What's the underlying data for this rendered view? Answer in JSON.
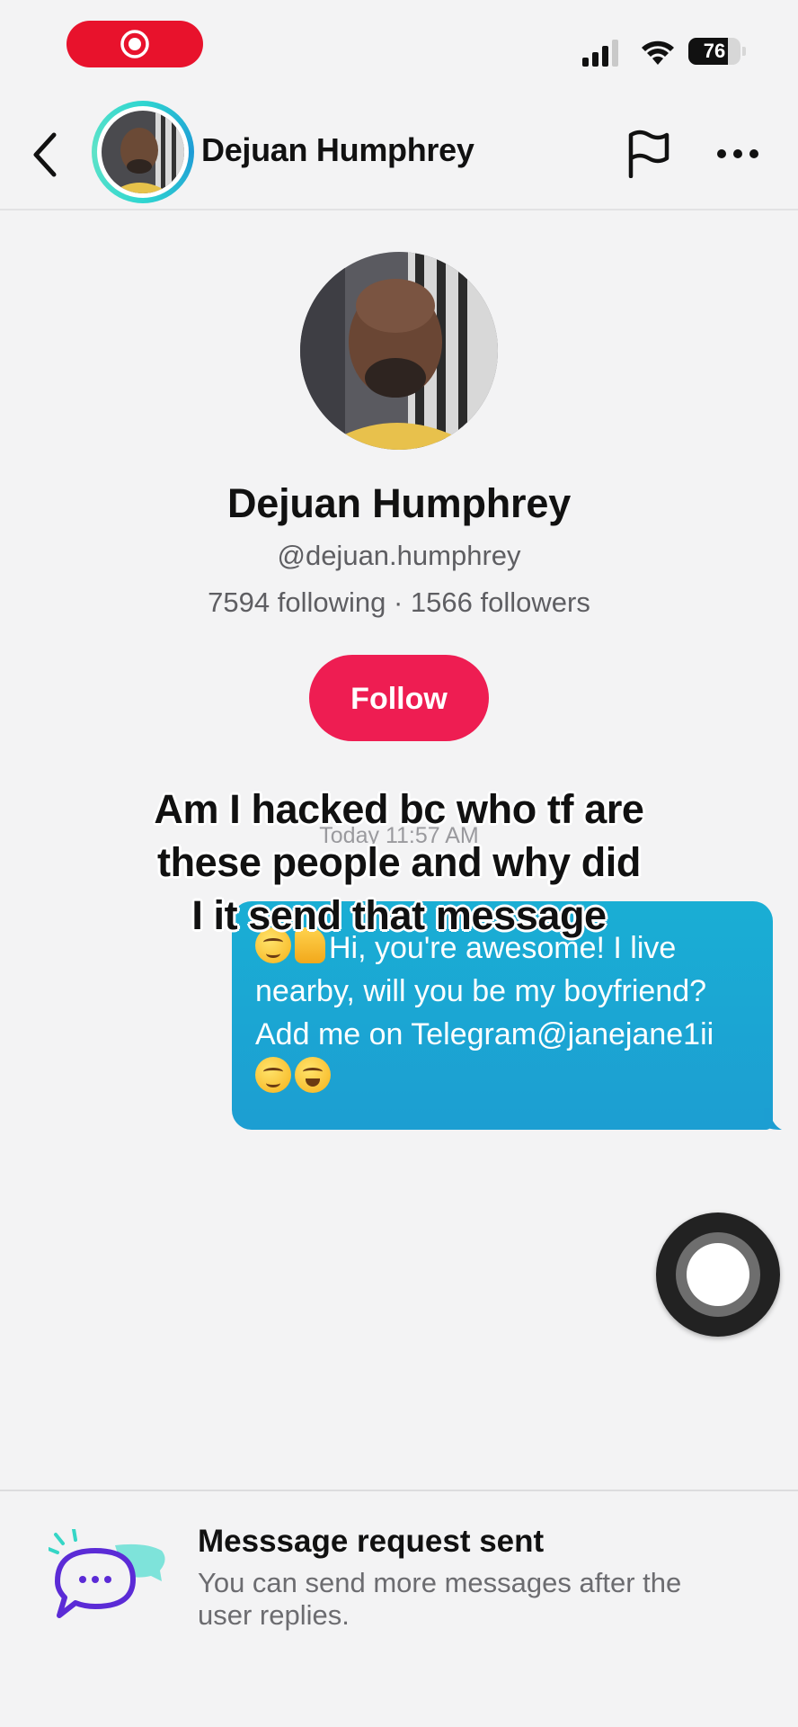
{
  "status_bar": {
    "battery_level": "76",
    "battery_fraction": 0.76,
    "icons": [
      "screen-recording-icon",
      "cellular-signal-icon",
      "wifi-icon",
      "battery-icon"
    ]
  },
  "header": {
    "name": "Dejuan Humphrey",
    "icons": [
      "back-chevron-icon",
      "flag-icon",
      "more-dots-icon"
    ]
  },
  "profile": {
    "name": "Dejuan Humphrey",
    "handle": "@dejuan.humphrey",
    "stats": "7594 following · 1566 followers",
    "follow_label": "Follow"
  },
  "chat": {
    "timestamp": "Today 11:57 AM",
    "message": {
      "line1": "Hi, you're awesome! I live",
      "line2": "nearby, will you be my boyfriend?",
      "line3": "Add me on Telegram@janejane1ii"
    }
  },
  "overlay_caption": {
    "line1": "Am I hacked bc who tf are",
    "line2": "these people and why did",
    "line3": "I it send that message"
  },
  "footer": {
    "title": "Messsage request sent",
    "subtitle": "You can send more messages after the user replies."
  },
  "colors": {
    "accent_red": "#ee1d52",
    "bubble_blue": "#1aa8d4",
    "background": "#f3f3f4"
  }
}
